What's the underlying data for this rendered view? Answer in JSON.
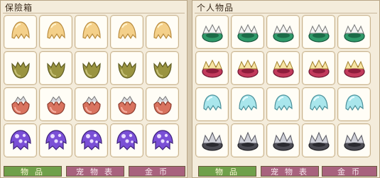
{
  "warehouse": {
    "title": "保險箱",
    "tabs": [
      {
        "label": "物品",
        "active": true
      },
      {
        "label": "宠物表",
        "active": false
      },
      {
        "label": "金币",
        "active": false
      }
    ],
    "rows": [
      {
        "icon": "cream-egg-shell-icon",
        "count": 5
      },
      {
        "icon": "olive-egg-shell-icon",
        "count": 5
      },
      {
        "icon": "red-egg-shell-icon",
        "count": 5
      },
      {
        "icon": "purple-spotted-egg-shell-icon",
        "count": 5
      }
    ]
  },
  "personal": {
    "title": "个人物品",
    "tabs": [
      {
        "label": "物品",
        "active": true
      },
      {
        "label": "宠物表",
        "active": false
      },
      {
        "label": "金币",
        "active": false
      }
    ],
    "rows": [
      {
        "icon": "green-crown-shell-icon",
        "count": 5
      },
      {
        "icon": "crimson-crown-shell-icon",
        "count": 5
      },
      {
        "icon": "cyan-egg-shell-icon",
        "count": 5
      },
      {
        "icon": "gray-spiked-shell-icon",
        "count": 5
      }
    ]
  },
  "colors": {
    "active_tab": "#6fa04a",
    "inactive_tab": "#a8627e",
    "panel_bg": "#f4ecdb",
    "slot_bg": "#fffdf6"
  }
}
